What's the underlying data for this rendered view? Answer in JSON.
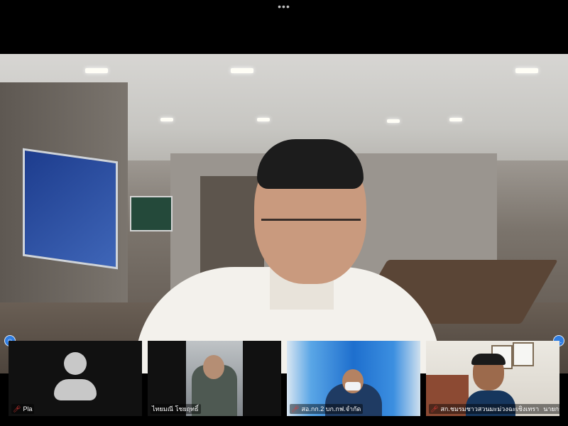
{
  "top_bar": {
    "menu_icon": "more-dots-icon",
    "menu_glyph": "•••"
  },
  "main_video": {
    "speaker": "main-participant"
  },
  "controls": {
    "left_icon": "participants-icon",
    "right_icon": "more-icon",
    "left_glyph": "☺",
    "right_glyph": "…"
  },
  "tiles": [
    {
      "name": "Pla",
      "muted": true,
      "video": false
    },
    {
      "name": "ไทยมณี โชยฤทธิ์",
      "muted": false,
      "video": true
    },
    {
      "name": "สอ.กก.2 บก.กฟ.จำกัด",
      "muted": true,
      "video": true
    },
    {
      "name": "สก.ชมรมชาวสวนมะม่วงฉะเชิงเทรา",
      "extra": "นายกระจำ...",
      "muted": true,
      "video": true
    }
  ],
  "mic_glyph": "🎤︎"
}
